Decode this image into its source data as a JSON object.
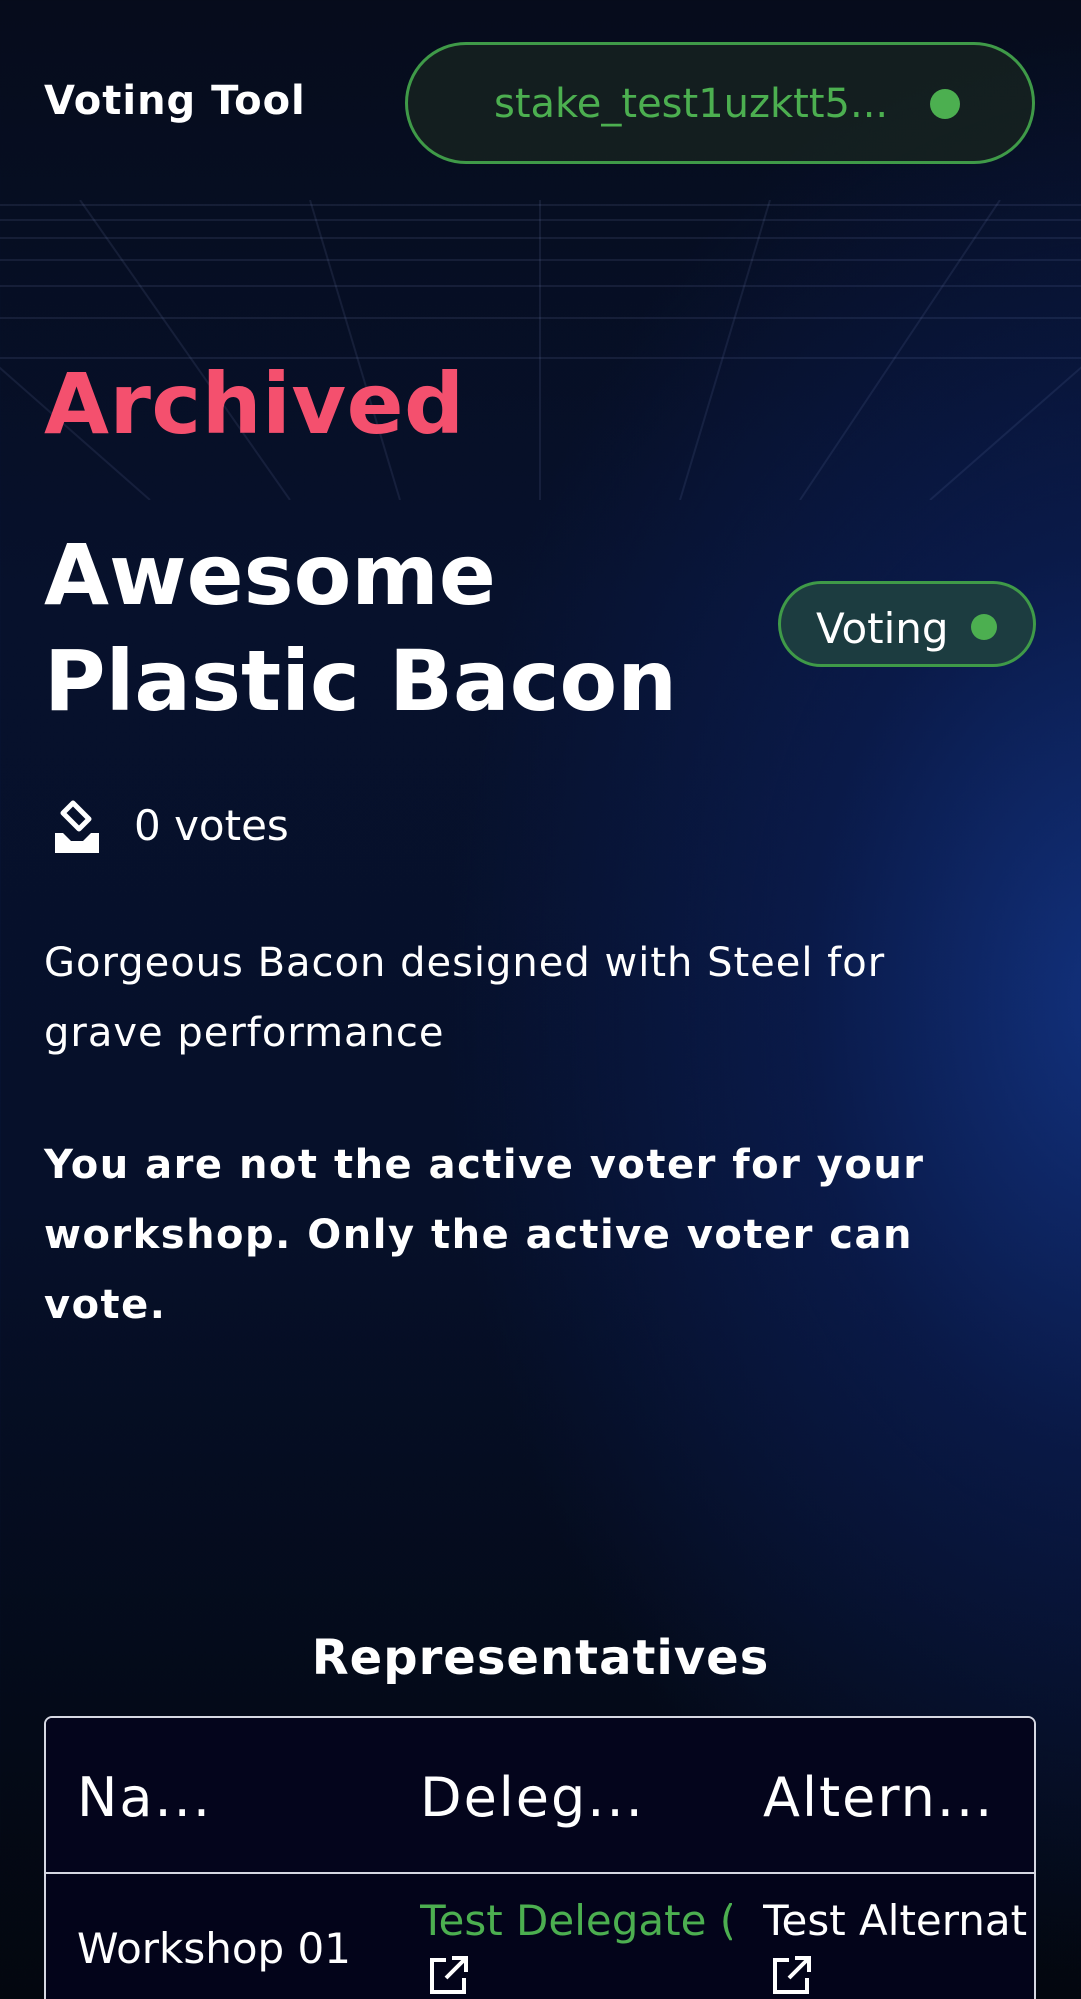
{
  "header": {
    "app_title": "Voting Tool",
    "wallet_address": "stake_test1uzktt5..."
  },
  "proposal": {
    "status": "Archived",
    "title": "Awesome Plastic Bacon",
    "voting_badge": "Voting",
    "votes_label": "0 votes",
    "description": "Gorgeous Bacon designed with Steel for grave performance",
    "warning": "You are not the active voter for your workshop. Only the active voter can vote."
  },
  "representatives": {
    "title": "Representatives",
    "columns": [
      "Na...",
      "Deleg...",
      "Altern..."
    ],
    "rows": [
      {
        "name": "Workshop 01",
        "delegate": "Test Delegate (",
        "alternate": "Test Alternat"
      }
    ]
  },
  "colors": {
    "accent_green": "#4caf50",
    "archived_red": "#f4506e",
    "background": "#06102a"
  },
  "icons": {
    "votes": "ballot-box-icon",
    "wallet_status": "status-dot-icon",
    "external_link": "external-link-icon"
  }
}
